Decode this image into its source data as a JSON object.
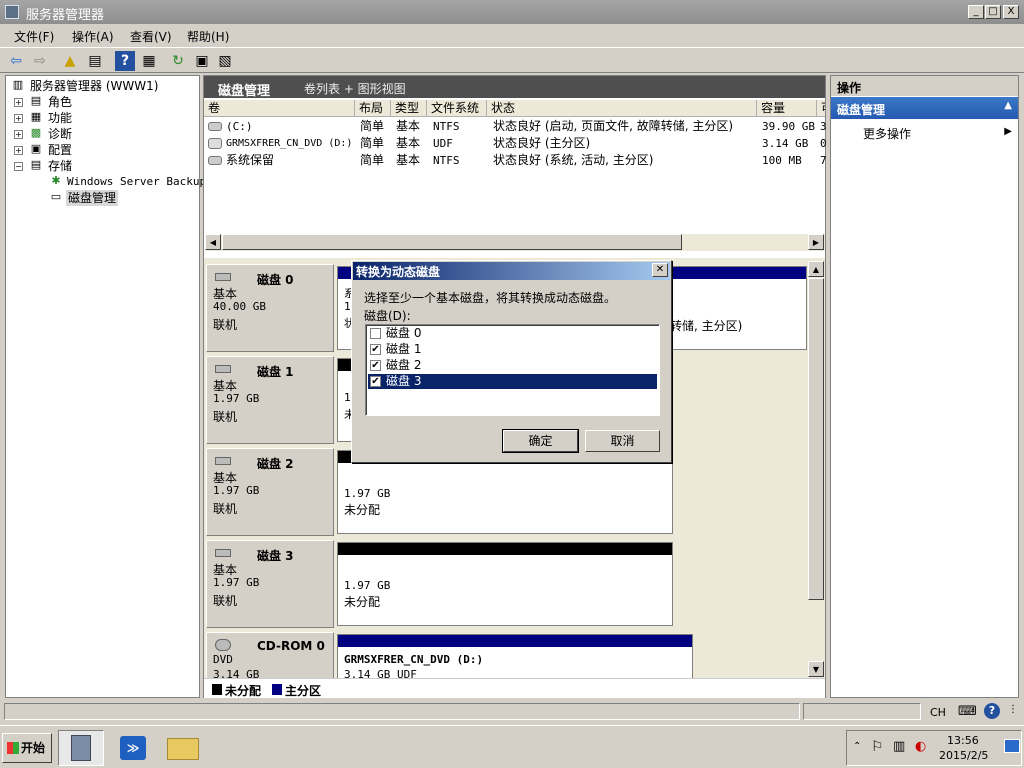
{
  "window": {
    "title": "服务器管理器",
    "controls": [
      "_",
      "□",
      "X"
    ]
  },
  "menu": [
    "文件(F)",
    "操作(A)",
    "查看(V)",
    "帮助(H)"
  ],
  "toolbar_icons": [
    "back-icon",
    "forward-icon",
    "up-folder-icon",
    "show-hide-tree-icon",
    "help-icon",
    "view-icon",
    "refresh-icon",
    "properties-icon",
    "export-icon"
  ],
  "tree": {
    "root": "服务器管理器 (WWW1)",
    "items": [
      {
        "label": "角色"
      },
      {
        "label": "功能"
      },
      {
        "label": "诊断"
      },
      {
        "label": "配置"
      },
      {
        "label": "存储"
      }
    ],
    "children": [
      {
        "label": "Windows Server Backup"
      },
      {
        "label": "磁盘管理"
      }
    ]
  },
  "center": {
    "title": "磁盘管理",
    "view": "卷列表 + 图形视图",
    "columns": [
      "卷",
      "布局",
      "类型",
      "文件系统",
      "状态",
      "容量",
      "可"
    ],
    "rows": [
      {
        "vol": "(C:)",
        "layout": "简单",
        "type": "基本",
        "fs": "NTFS",
        "status": "状态良好 (启动, 页面文件, 故障转储, 主分区)",
        "cap": "39.90 GB",
        "free": "3"
      },
      {
        "vol": "GRMSXFRER_CN_DVD (D:)",
        "layout": "简单",
        "type": "基本",
        "fs": "UDF",
        "status": "状态良好 (主分区)",
        "cap": "3.14 GB",
        "free": "0"
      },
      {
        "vol": "系统保留",
        "layout": "简单",
        "type": "基本",
        "fs": "NTFS",
        "status": "状态良好 (系统, 活动, 主分区)",
        "cap": "100 MB",
        "free": "7"
      }
    ]
  },
  "disks": [
    {
      "name": "磁盘 0",
      "kind": "基本",
      "size": "40.00 GB",
      "state": "联机",
      "vol_a": "系",
      "vol_b": "1",
      "vol_c": "状",
      "vol_tail": "转储, 主分区)"
    },
    {
      "name": "磁盘 1",
      "kind": "基本",
      "size": "1.97 GB",
      "state": "联机",
      "vol_a": "1",
      "vol_b": "未"
    },
    {
      "name": "磁盘 2",
      "kind": "基本",
      "size": "1.97 GB",
      "state": "联机",
      "vol_size": "1.97 GB",
      "vol_state": "未分配"
    },
    {
      "name": "磁盘 3",
      "kind": "基本",
      "size": "1.97 GB",
      "state": "联机",
      "vol_size": "1.97 GB",
      "vol_state": "未分配"
    },
    {
      "name": "CD-ROM 0",
      "kind": "DVD",
      "size": "3.14 GB",
      "vol_name": "GRMSXFRER_CN_DVD  (D:)",
      "vol_size": "3.14 GB UDF"
    }
  ],
  "legend": {
    "unallocated": "未分配",
    "primary": "主分区",
    "unallocated_color": "#000000",
    "primary_color": "#000080"
  },
  "actions": {
    "header": "操作",
    "section": "磁盘管理",
    "more": "更多操作"
  },
  "dialog": {
    "title": "转换为动态磁盘",
    "prompt": "选择至少一个基本磁盘，将其转换成动态磁盘。",
    "list_label": "磁盘(D):",
    "items": [
      {
        "label": "磁盘 0",
        "checked": false
      },
      {
        "label": "磁盘 1",
        "checked": true
      },
      {
        "label": "磁盘 2",
        "checked": true
      },
      {
        "label": "磁盘 3",
        "checked": true
      }
    ],
    "ok": "确定",
    "cancel": "取消"
  },
  "taskbar": {
    "start": "开始",
    "tray": {
      "lang": "CH",
      "time": "13:56",
      "date": "2015/2/5"
    }
  }
}
